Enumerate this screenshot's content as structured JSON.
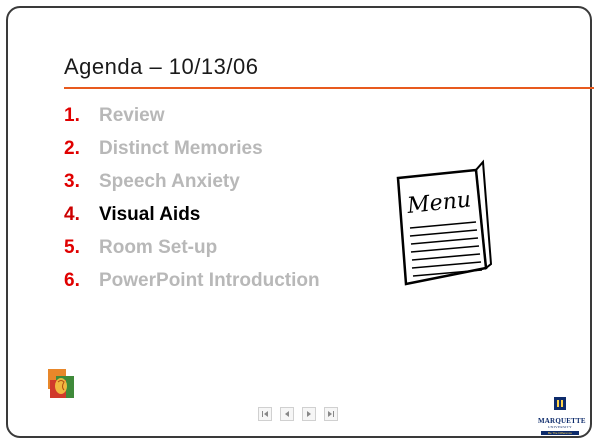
{
  "slide": {
    "title": "Agenda – 10/13/06",
    "accent_color": "#e85a1e",
    "number_color": "#e00000",
    "inactive_text_color": "#b8b8b8",
    "agenda": [
      {
        "num": "1.",
        "label": "Review",
        "active": false
      },
      {
        "num": "2.",
        "label": "Distinct Memories",
        "active": false
      },
      {
        "num": "3.",
        "label": "Speech Anxiety",
        "active": false
      },
      {
        "num": "4.",
        "label": "Visual Aids",
        "active": true
      },
      {
        "num": "5.",
        "label": "Room Set-up",
        "active": false
      },
      {
        "num": "6.",
        "label": "PowerPoint Introduction",
        "active": false
      }
    ],
    "menu_card_text": "Menu",
    "logo_right": {
      "word": "MARQUETTE",
      "sub": "UNIVERSITY",
      "tagline": "Be The Difference"
    }
  },
  "nav": [
    {
      "icon": "first-slide-icon"
    },
    {
      "icon": "previous-slide-icon"
    },
    {
      "icon": "next-slide-icon"
    },
    {
      "icon": "last-slide-icon"
    }
  ]
}
